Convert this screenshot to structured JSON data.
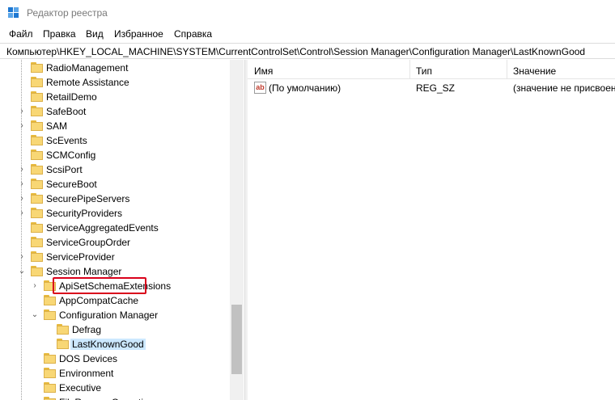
{
  "window": {
    "title": "Редактор реестра",
    "icon": "registry-editor-icon"
  },
  "menu": [
    "Файл",
    "Правка",
    "Вид",
    "Избранное",
    "Справка"
  ],
  "address": "Компьютер\\HKEY_LOCAL_MACHINE\\SYSTEM\\CurrentControlSet\\Control\\Session Manager\\Configuration Manager\\LastKnownGood",
  "tree": {
    "items": [
      {
        "label": "RadioManagement",
        "expand": ""
      },
      {
        "label": "Remote Assistance",
        "expand": ""
      },
      {
        "label": "RetailDemo",
        "expand": ""
      },
      {
        "label": "SafeBoot",
        "expand": "›"
      },
      {
        "label": "SAM",
        "expand": "›"
      },
      {
        "label": "ScEvents",
        "expand": ""
      },
      {
        "label": "SCMConfig",
        "expand": ""
      },
      {
        "label": "ScsiPort",
        "expand": "›"
      },
      {
        "label": "SecureBoot",
        "expand": "›"
      },
      {
        "label": "SecurePipeServers",
        "expand": "›"
      },
      {
        "label": "SecurityProviders",
        "expand": "›"
      },
      {
        "label": "ServiceAggregatedEvents",
        "expand": ""
      },
      {
        "label": "ServiceGroupOrder",
        "expand": ""
      },
      {
        "label": "ServiceProvider",
        "expand": "›"
      },
      {
        "label": "Session Manager",
        "expand": "⌄"
      },
      {
        "label": "ApiSetSchemaExtensions",
        "expand": "›"
      },
      {
        "label": "AppCompatCache",
        "expand": ""
      },
      {
        "label": "Configuration Manager",
        "expand": "⌄"
      },
      {
        "label": "Defrag",
        "expand": ""
      },
      {
        "label": "LastKnownGood",
        "expand": ""
      },
      {
        "label": "DOS Devices",
        "expand": ""
      },
      {
        "label": "Environment",
        "expand": ""
      },
      {
        "label": "Executive",
        "expand": ""
      },
      {
        "label": "FileRenameOperations",
        "expand": ""
      }
    ]
  },
  "list": {
    "columns": [
      "Имя",
      "Тип",
      "Значение"
    ],
    "rows": [
      {
        "icon": "ab-string-icon",
        "icon_text": "ab",
        "name": "(По умолчанию)",
        "type": "REG_SZ",
        "value": "(значение не присвоено)"
      }
    ]
  },
  "colors": {
    "highlight_border": "#d9001b",
    "selection": "#cce8ff",
    "folder": "#f8d775"
  }
}
